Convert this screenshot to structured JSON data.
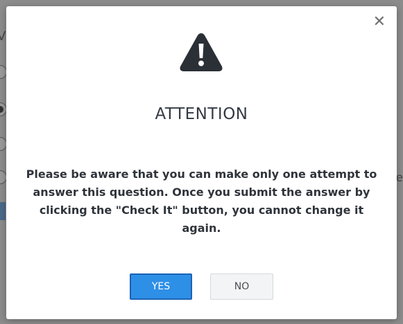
{
  "dialog": {
    "close_glyph": "✕",
    "warning_icon": "warning-triangle-icon",
    "title": "ATTENTION",
    "message_lines": [
      "Please be aware that you can make only one attempt to",
      "answer this question. Once you submit the answer by",
      "clicking the \"Check It\" button, you cannot change it",
      "again."
    ],
    "yes_label": "YES",
    "no_label": "NO"
  },
  "background": {
    "partial_letter": "V",
    "partial_tail": "ge"
  },
  "colors": {
    "primary_button": "#2e8fe7",
    "icon_dark": "#2b2f36",
    "title_text": "#333a44"
  }
}
